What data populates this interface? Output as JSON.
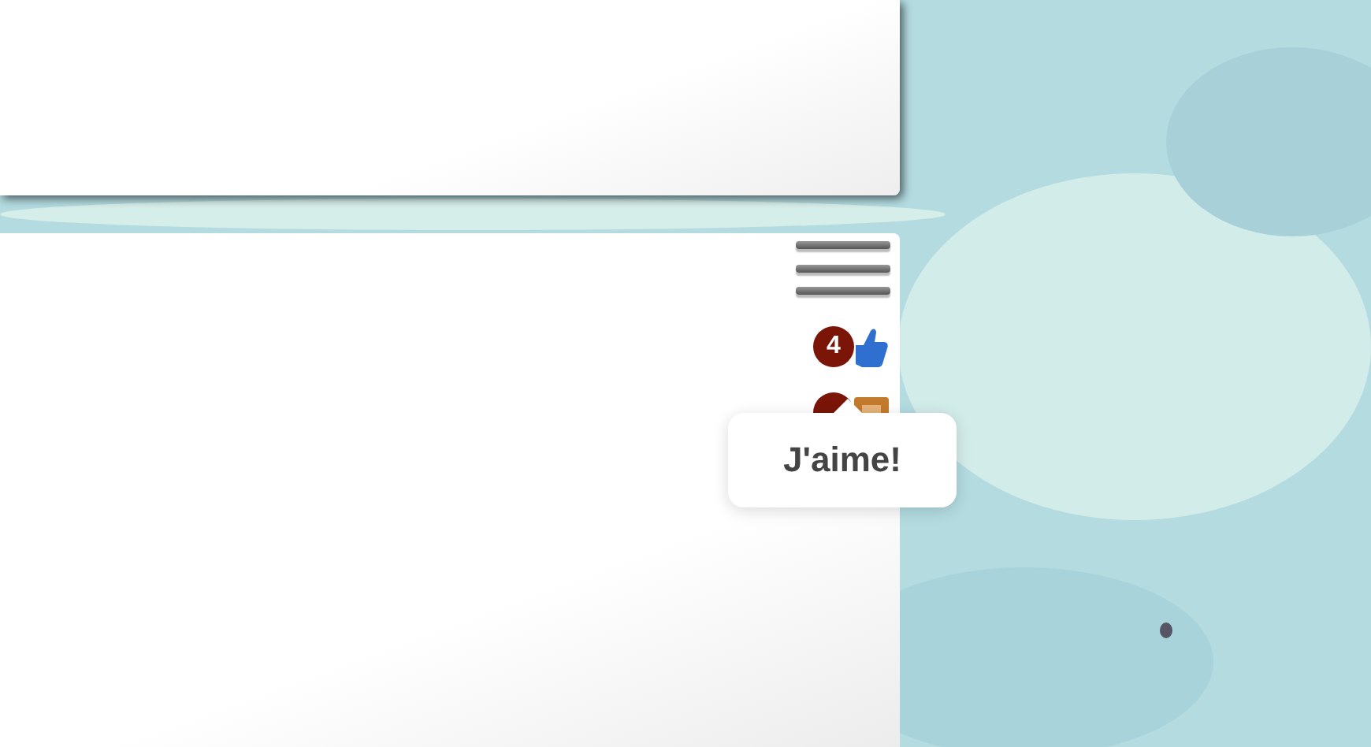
{
  "menu": {
    "kind": "hamburger"
  },
  "actions": [
    {
      "kind": "like",
      "badge": "4"
    },
    {
      "kind": "share"
    }
  ],
  "tooltip": {
    "text": "J'aime!"
  }
}
